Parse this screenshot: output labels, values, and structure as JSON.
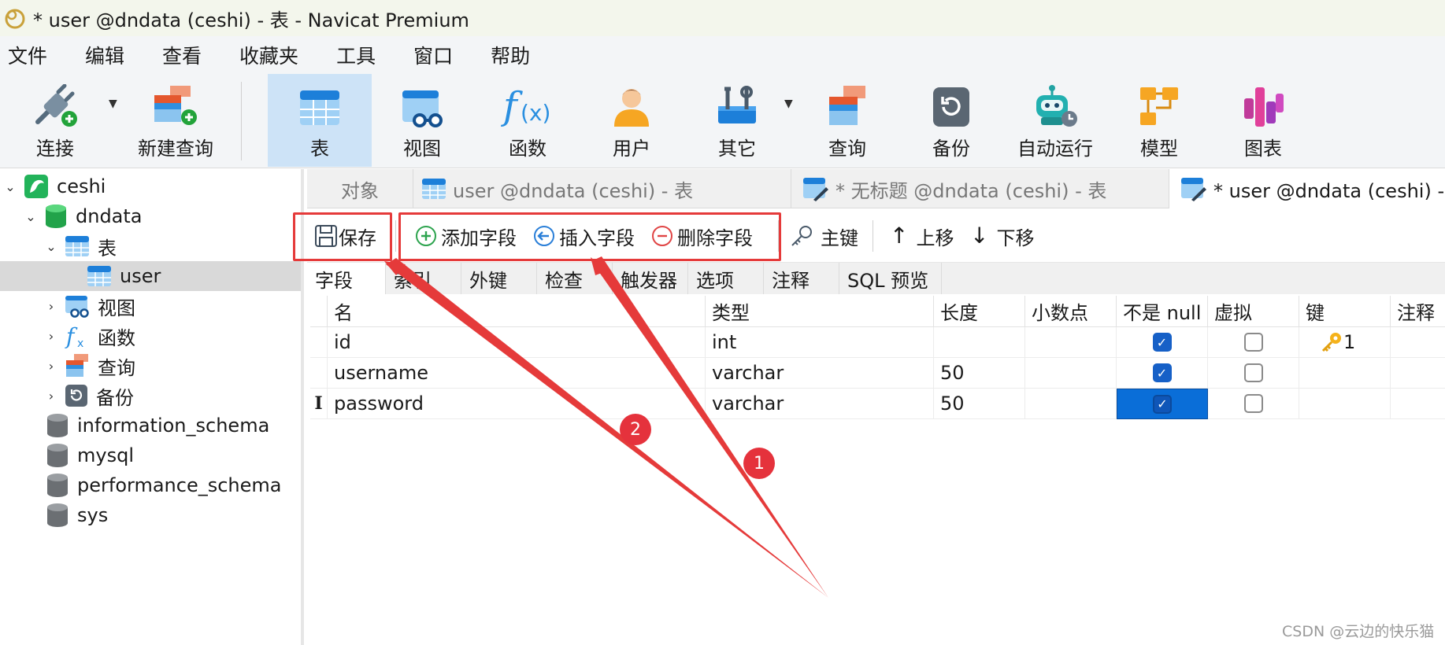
{
  "window": {
    "title": "* user @dndata (ceshi) - 表 - Navicat Premium"
  },
  "menu": [
    "文件",
    "编辑",
    "查看",
    "收藏夹",
    "工具",
    "窗口",
    "帮助"
  ],
  "toolbar": {
    "connect": "连接",
    "new_query": "新建查询",
    "table": "表",
    "view": "视图",
    "function": "函数",
    "user": "用户",
    "other": "其它",
    "query": "查询",
    "backup": "备份",
    "automation": "自动运行",
    "model": "模型",
    "chart": "图表"
  },
  "sidebar": {
    "connection": "ceshi",
    "database": "dndata",
    "tables_group": "表",
    "table_user": "user",
    "views_group": "视图",
    "functions_group": "函数",
    "queries_group": "查询",
    "backups_group": "备份",
    "db_information_schema": "information_schema",
    "db_mysql": "mysql",
    "db_performance_schema": "performance_schema",
    "db_sys": "sys"
  },
  "tabs": {
    "objects": "对象",
    "tab1": "user @dndata (ceshi) - 表",
    "tab2": "* 无标题 @dndata (ceshi) - 表",
    "tab3": "* user @dndata (ceshi) - 表"
  },
  "editor_toolbar": {
    "save": "保存",
    "add_field": "添加字段",
    "insert_field": "插入字段",
    "delete_field": "删除字段",
    "primary_key": "主键",
    "move_up": "上移",
    "move_down": "下移"
  },
  "subtabs": [
    "字段",
    "索引",
    "外键",
    "检查",
    "触发器",
    "选项",
    "注释",
    "SQL 预览"
  ],
  "grid": {
    "headers": [
      "名",
      "类型",
      "长度",
      "小数点",
      "不是 null",
      "虚拟",
      "键",
      "注释"
    ],
    "rows": [
      {
        "name": "id",
        "type": "int",
        "length": "",
        "not_null": true,
        "virtual": false,
        "key": "1"
      },
      {
        "name": "username",
        "type": "varchar",
        "length": "50",
        "not_null": true,
        "virtual": false,
        "key": ""
      },
      {
        "name": "password",
        "type": "varchar",
        "length": "50",
        "not_null": true,
        "virtual": false,
        "key": ""
      }
    ]
  },
  "annotations": {
    "badge1": "1",
    "badge2": "2",
    "color": "#e53a3a"
  },
  "watermark": "CSDN @云边的快乐猫"
}
